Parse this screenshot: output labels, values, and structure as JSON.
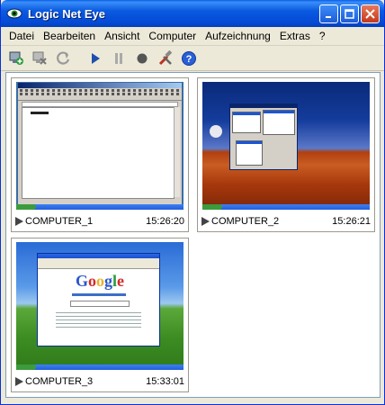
{
  "window": {
    "title": "Logic Net Eye"
  },
  "menu": [
    "Datei",
    "Bearbeiten",
    "Ansicht",
    "Computer",
    "Aufzeichnung",
    "Extras",
    "?"
  ],
  "toolbar": {
    "icons": [
      "add-computer-icon",
      "remove-computer-icon",
      "refresh-icon",
      "play-icon",
      "pause-icon",
      "record-icon",
      "tools-icon",
      "help-icon"
    ]
  },
  "tiles": [
    {
      "name": "COMPUTER_1",
      "time": "15:26:20"
    },
    {
      "name": "COMPUTER_2",
      "time": "15:26:21"
    },
    {
      "name": "COMPUTER_3",
      "time": "15:33:01"
    }
  ],
  "colors": {
    "titlebar": "#0a5ae0",
    "chrome": "#ece9d8",
    "accent": "#245edb"
  }
}
